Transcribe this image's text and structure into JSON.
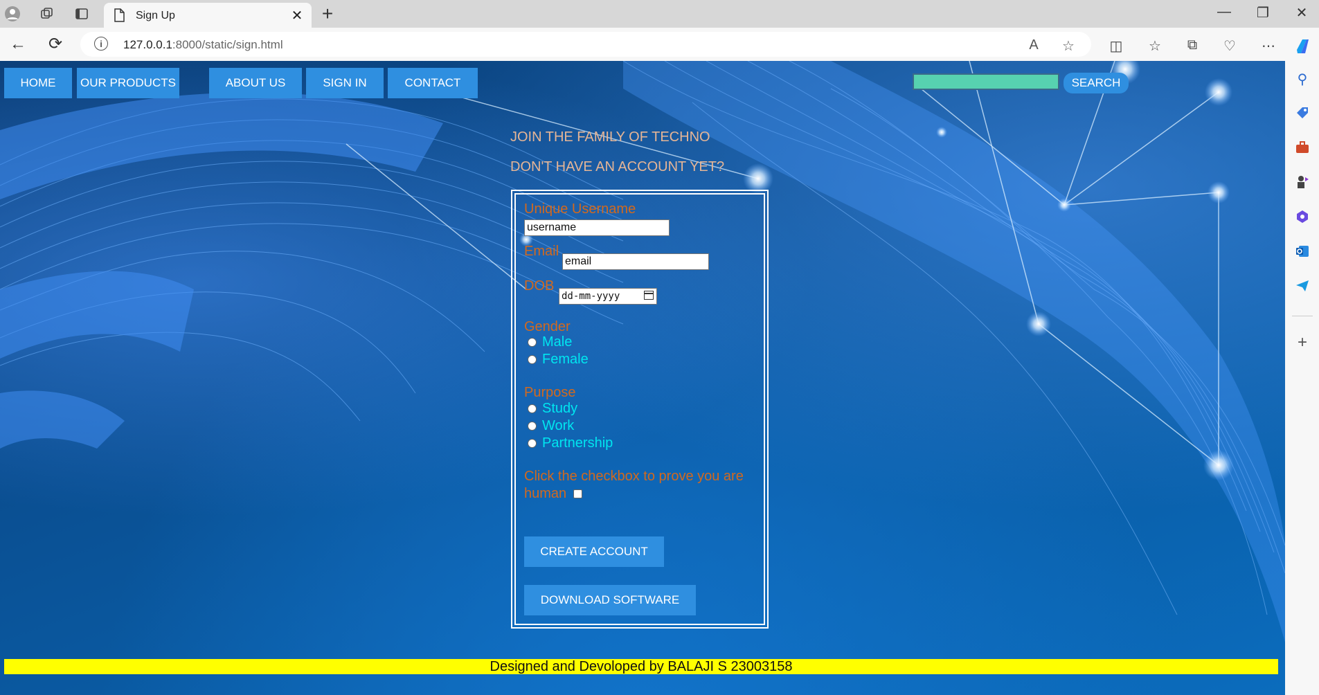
{
  "browser": {
    "tab_title": "Sign Up",
    "url_host": "127.0.0.1",
    "url_path": ":8000/static/sign.html"
  },
  "nav": {
    "items": [
      {
        "label": "HOME"
      },
      {
        "label": "OUR PRODUCTS"
      },
      {
        "label": "ABOUT US"
      },
      {
        "label": "SIGN IN"
      },
      {
        "label": "CONTACT"
      }
    ],
    "search_value": "",
    "search_button": "SEARCH"
  },
  "headings": {
    "line1": "JOIN THE FAMILY OF TECHNO",
    "line2": "DON'T HAVE AN ACCOUNT YET?"
  },
  "form": {
    "username_label": "Unique Username",
    "username_value": "username",
    "email_label": "Email",
    "email_value": "email",
    "dob_label": "DOB",
    "dob_placeholder": "dd-mm-yyyy",
    "gender_label": "Gender",
    "gender_options": [
      "Male",
      "Female"
    ],
    "purpose_label": "Purpose",
    "purpose_options": [
      "Study",
      "Work",
      "Partnership"
    ],
    "human_label_line1": "Click the checkbox to prove you are",
    "human_label_line2": "human",
    "create_button": "CREATE ACCOUNT",
    "download_button": "DOWNLOAD SOFTWARE"
  },
  "footer": {
    "text": "Designed and Devoloped by BALAJI S 23003158"
  },
  "colors": {
    "nav_bg": "#2f8fe0",
    "label_orange": "#d2691e",
    "option_cyan": "#00e6f0",
    "footer_bg": "#ffff00",
    "search_field": "#57d2b0"
  }
}
